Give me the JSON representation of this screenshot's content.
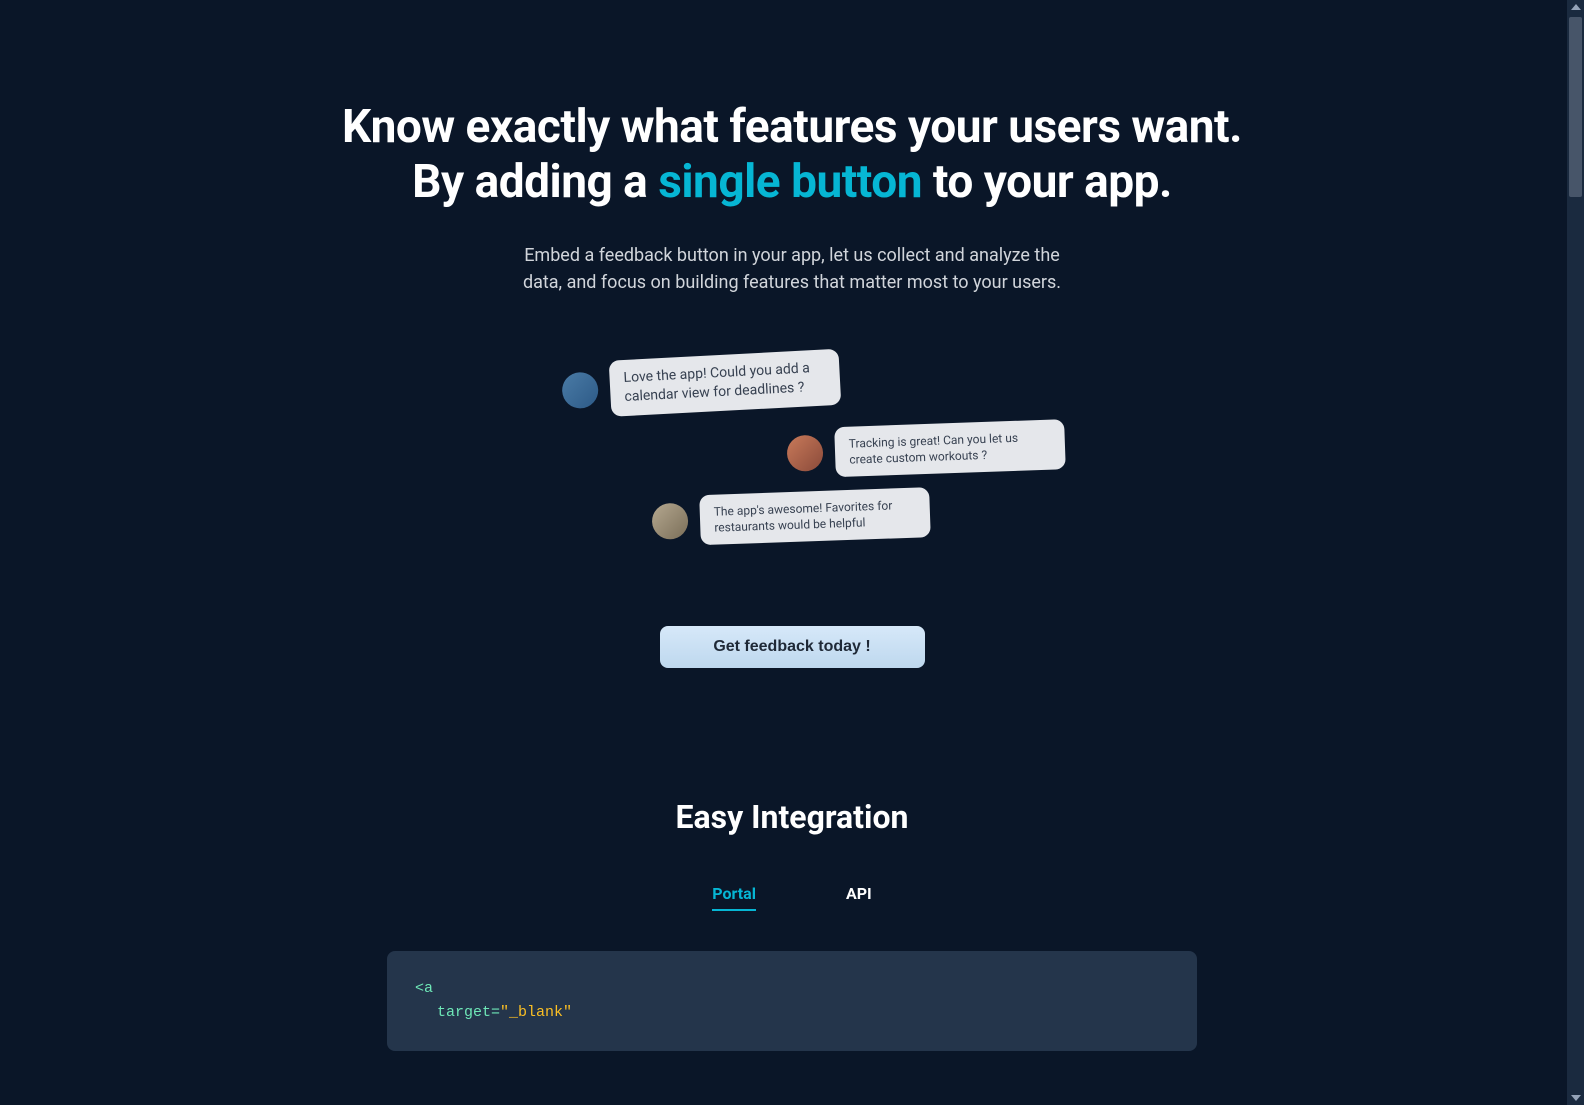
{
  "hero": {
    "title_line1": "Know exactly what features your users want.",
    "title_line2_before": "By adding a ",
    "title_line2_accent": "single button",
    "title_line2_after": " to your app.",
    "subtitle": "Embed a feedback button in your app, let us collect and analyze the data, and focus on building features that matter most to your users."
  },
  "messages": [
    {
      "text": "Love the app! Could you add a calendar view for deadlines ?"
    },
    {
      "text": "Tracking is great! Can you let us create custom workouts ?"
    },
    {
      "text": "The app's awesome! Favorites for restaurants would be helpful"
    }
  ],
  "cta": {
    "label": "Get feedback today !"
  },
  "integration": {
    "title": "Easy Integration",
    "tabs": {
      "portal": "Portal",
      "api": "API"
    },
    "code": {
      "line1_tag": "<a",
      "line2_attr": "target=",
      "line2_val": "\"_blank\""
    }
  }
}
